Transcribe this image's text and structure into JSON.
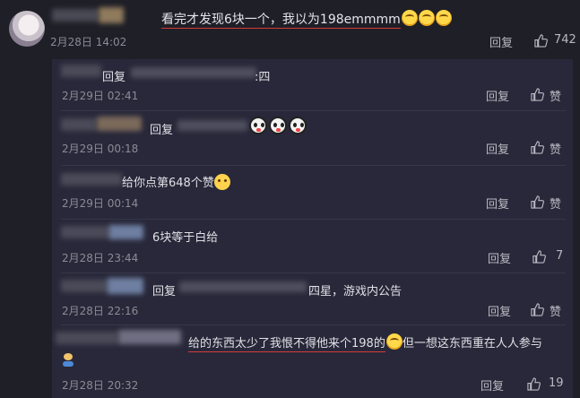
{
  "main_comment": {
    "text": "看完才发现6块一个，我以为198emmmm",
    "timestamp": "2月28日 14:02",
    "reply_label": "回复",
    "like_count": "742",
    "emoji_count_icons": [
      "laughing-tears-emoji",
      "laughing-tears-emoji",
      "laughing-tears-emoji"
    ]
  },
  "replies": [
    {
      "prefix": "回复",
      "text": ":四",
      "timestamp": "2月29日 02:41",
      "reply_label": "回复",
      "like_label": "赞"
    },
    {
      "prefix": "回复",
      "text": "",
      "timestamp": "2月29日 00:18",
      "reply_label": "回复",
      "like_label": "赞",
      "icons": [
        "panda-face-emoji",
        "panda-face-emoji",
        "panda-face-emoji"
      ]
    },
    {
      "prefix": "",
      "text": "给你点第648个赞",
      "timestamp": "2月29日 00:14",
      "reply_label": "回复",
      "like_label": "赞",
      "icons": [
        "doge-emoji"
      ]
    },
    {
      "prefix": "",
      "text": "6块等于白给",
      "timestamp": "2月28日 23:44",
      "reply_label": "回复",
      "like_count": "7"
    },
    {
      "prefix": "回复",
      "text": "四星，游戏内公告",
      "timestamp": "2月28日 22:16",
      "reply_label": "回复",
      "like_label": "赞"
    },
    {
      "prefix": "",
      "text_underlined": "给的东西太少了我恨不得他来个198的",
      "text": "但一想这东西重在人人参与",
      "timestamp": "2月28日 20:32",
      "reply_label": "回复",
      "like_count": "19",
      "icons": [
        "laughing-tears-emoji"
      ]
    }
  ],
  "colors": {
    "background": "#1f1f27",
    "thread_background": "#28283a",
    "underline": "#d23b3b",
    "meta_text": "#8b8b96"
  }
}
